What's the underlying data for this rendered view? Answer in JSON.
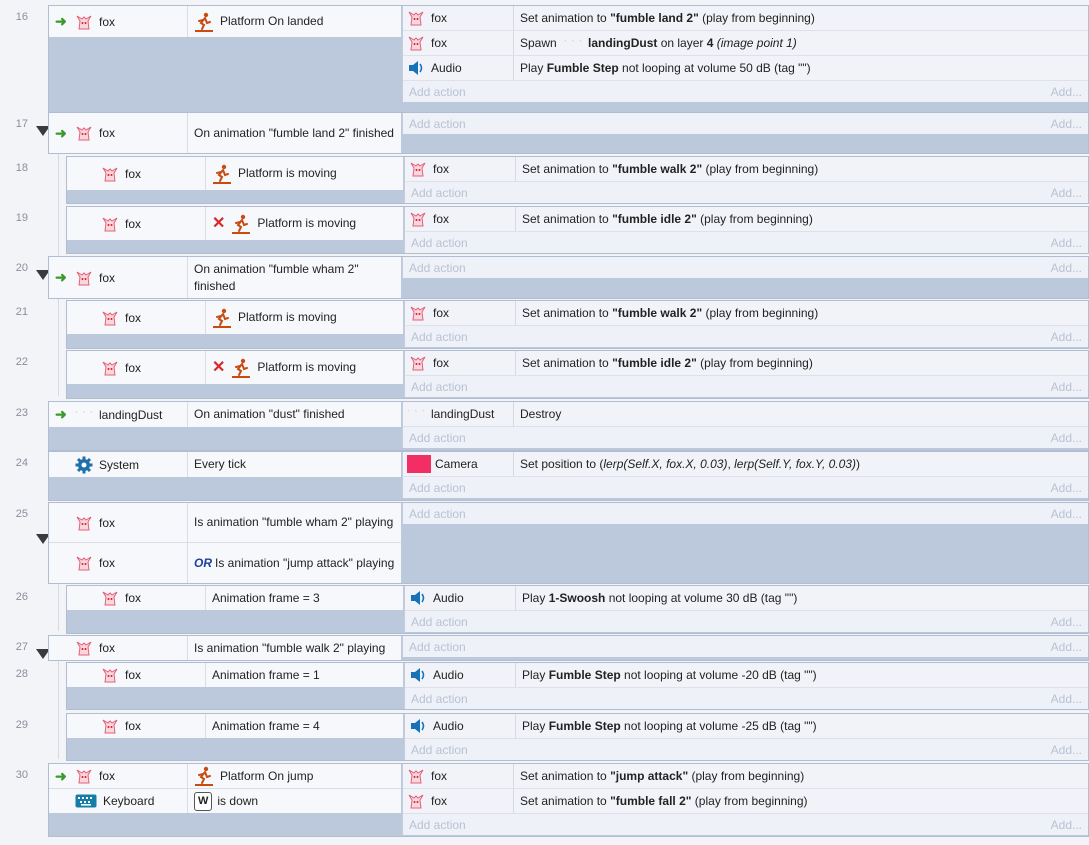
{
  "add_action": "Add action",
  "add_short": "Add...",
  "events": [
    {
      "num": "16",
      "collapse": false,
      "conds": [
        {
          "trigger": true,
          "obj": "fox",
          "icon": "fox-icon",
          "kind": "platform",
          "parts": [
            {
              "t": "Platform On landed"
            }
          ]
        }
      ],
      "actions": [
        {
          "obj": "fox",
          "icon": "fox-icon",
          "parts": [
            {
              "t": "Set animation to "
            },
            {
              "t": "\"fumble land 2\"",
              "b": true
            },
            {
              "t": " (play from beginning)"
            }
          ]
        },
        {
          "obj": "fox",
          "icon": "fox-icon",
          "parts": [
            {
              "t": "Spawn "
            },
            {
              "t": "landingDust",
              "b": true,
              "dust": true
            },
            {
              "t": " on layer "
            },
            {
              "t": "4",
              "b": true
            },
            {
              "t": " "
            },
            {
              "t": "(image point 1)",
              "i": true
            }
          ]
        },
        {
          "obj": "Audio",
          "icon": "audio-icon",
          "parts": [
            {
              "t": "Play "
            },
            {
              "t": "Fumble Step",
              "b": true
            },
            {
              "t": " not looping at volume 50 dB (tag \"\")"
            }
          ]
        }
      ]
    },
    {
      "num": "17",
      "collapse": true,
      "conds": [
        {
          "trigger": true,
          "obj": "fox",
          "icon": "fox-icon",
          "parts": [
            {
              "t": "On animation \"fumble land 2\" finished"
            }
          ]
        }
      ],
      "actions": []
    },
    {
      "num": "18",
      "collapse": false,
      "sub": true,
      "conds": [
        {
          "obj": "fox",
          "icon": "fox-icon",
          "kind": "platform",
          "parts": [
            {
              "t": "Platform is moving"
            }
          ]
        }
      ],
      "actions": [
        {
          "obj": "fox",
          "icon": "fox-icon",
          "parts": [
            {
              "t": "Set animation to "
            },
            {
              "t": "\"fumble walk 2\"",
              "b": true
            },
            {
              "t": " (play from beginning)"
            }
          ]
        }
      ]
    },
    {
      "num": "19",
      "collapse": false,
      "sub": true,
      "conds": [
        {
          "obj": "fox",
          "icon": "fox-icon",
          "kind": "platform",
          "invert": true,
          "parts": [
            {
              "t": "Platform is moving"
            }
          ]
        }
      ],
      "actions": [
        {
          "obj": "fox",
          "icon": "fox-icon",
          "parts": [
            {
              "t": "Set animation to "
            },
            {
              "t": "\"fumble idle 2\"",
              "b": true
            },
            {
              "t": " (play from beginning)"
            }
          ]
        }
      ]
    },
    {
      "num": "20",
      "collapse": true,
      "conds": [
        {
          "trigger": true,
          "obj": "fox",
          "icon": "fox-icon",
          "parts": [
            {
              "t": "On animation \"fumble wham 2\" finished"
            }
          ]
        }
      ],
      "actions": []
    },
    {
      "num": "21",
      "collapse": false,
      "sub": true,
      "conds": [
        {
          "obj": "fox",
          "icon": "fox-icon",
          "kind": "platform",
          "parts": [
            {
              "t": "Platform is moving"
            }
          ]
        }
      ],
      "actions": [
        {
          "obj": "fox",
          "icon": "fox-icon",
          "parts": [
            {
              "t": "Set animation to "
            },
            {
              "t": "\"fumble walk 2\"",
              "b": true
            },
            {
              "t": " (play from beginning)"
            }
          ]
        }
      ]
    },
    {
      "num": "22",
      "collapse": false,
      "sub": true,
      "conds": [
        {
          "obj": "fox",
          "icon": "fox-icon",
          "kind": "platform",
          "invert": true,
          "parts": [
            {
              "t": "Platform is moving"
            }
          ]
        }
      ],
      "actions": [
        {
          "obj": "fox",
          "icon": "fox-icon",
          "parts": [
            {
              "t": "Set animation to "
            },
            {
              "t": "\"fumble idle 2\"",
              "b": true
            },
            {
              "t": " (play from beginning)"
            }
          ]
        }
      ]
    },
    {
      "num": "23",
      "collapse": false,
      "conds": [
        {
          "trigger": true,
          "obj": "landingDust",
          "icon": "dust-icon",
          "parts": [
            {
              "t": "On animation \"dust\" finished"
            }
          ]
        }
      ],
      "actions": [
        {
          "obj": "landingDust",
          "icon": "dust-icon",
          "parts": [
            {
              "t": "Destroy"
            }
          ]
        }
      ]
    },
    {
      "num": "24",
      "collapse": false,
      "conds": [
        {
          "obj": "System",
          "icon": "gear-icon",
          "parts": [
            {
              "t": "Every tick"
            }
          ]
        }
      ],
      "actions": [
        {
          "obj": "Camera",
          "icon": "camera-icon",
          "parts": [
            {
              "t": "Set position to ("
            },
            {
              "t": "lerp(Self.X, fox.X, 0.03)",
              "i": true
            },
            {
              "t": ", "
            },
            {
              "t": "lerp(Self.Y, fox.Y, 0.03)",
              "i": true
            },
            {
              "t": ")"
            }
          ]
        }
      ]
    },
    {
      "num": "25",
      "collapse": true,
      "conds": [
        {
          "obj": "fox",
          "icon": "fox-icon",
          "parts": [
            {
              "t": "Is animation \"fumble wham 2\" playing"
            }
          ]
        },
        {
          "obj": "fox",
          "icon": "fox-icon",
          "or": "OR",
          "parts": [
            {
              "t": "Is animation \"jump attack\" playing"
            }
          ]
        }
      ],
      "actions": []
    },
    {
      "num": "26",
      "collapse": false,
      "sub": true,
      "conds": [
        {
          "obj": "fox",
          "icon": "fox-icon",
          "parts": [
            {
              "t": "Animation frame = 3"
            }
          ]
        }
      ],
      "actions": [
        {
          "obj": "Audio",
          "icon": "audio-icon",
          "parts": [
            {
              "t": "Play "
            },
            {
              "t": "1-Swoosh",
              "b": true
            },
            {
              "t": " not looping at volume 30 dB (tag \"\")"
            }
          ]
        }
      ]
    },
    {
      "num": "27",
      "collapse": true,
      "conds": [
        {
          "obj": "fox",
          "icon": "fox-icon",
          "parts": [
            {
              "t": "Is animation \"fumble walk 2\" playing"
            }
          ]
        }
      ],
      "actions": []
    },
    {
      "num": "28",
      "collapse": false,
      "sub": true,
      "conds": [
        {
          "obj": "fox",
          "icon": "fox-icon",
          "parts": [
            {
              "t": "Animation frame = 1"
            }
          ]
        }
      ],
      "actions": [
        {
          "obj": "Audio",
          "icon": "audio-icon",
          "parts": [
            {
              "t": "Play "
            },
            {
              "t": "Fumble Step",
              "b": true
            },
            {
              "t": " not looping at volume -20 dB (tag \"\")"
            }
          ]
        }
      ]
    },
    {
      "num": "29",
      "collapse": false,
      "sub": true,
      "conds": [
        {
          "obj": "fox",
          "icon": "fox-icon",
          "parts": [
            {
              "t": "Animation frame = 4"
            }
          ]
        }
      ],
      "actions": [
        {
          "obj": "Audio",
          "icon": "audio-icon",
          "parts": [
            {
              "t": "Play "
            },
            {
              "t": "Fumble Step",
              "b": true
            },
            {
              "t": " not looping at volume -25 dB (tag \"\")"
            }
          ]
        }
      ]
    },
    {
      "num": "30",
      "collapse": false,
      "conds": [
        {
          "trigger": true,
          "obj": "fox",
          "icon": "fox-icon",
          "kind": "platform",
          "parts": [
            {
              "t": "Platform On jump"
            }
          ]
        },
        {
          "obj": "Keyboard",
          "icon": "keyboard-icon",
          "key": "W",
          "parts": [
            {
              "t": "is down"
            }
          ]
        }
      ],
      "actions": [
        {
          "obj": "fox",
          "icon": "fox-icon",
          "parts": [
            {
              "t": "Set animation to "
            },
            {
              "t": "\"jump attack\"",
              "b": true
            },
            {
              "t": " (play from beginning)"
            }
          ]
        },
        {
          "obj": "fox",
          "icon": "fox-icon",
          "parts": [
            {
              "t": "Set animation to "
            },
            {
              "t": "\"fumble fall 2\"",
              "b": true
            },
            {
              "t": " (play from beginning)"
            }
          ]
        }
      ]
    }
  ]
}
